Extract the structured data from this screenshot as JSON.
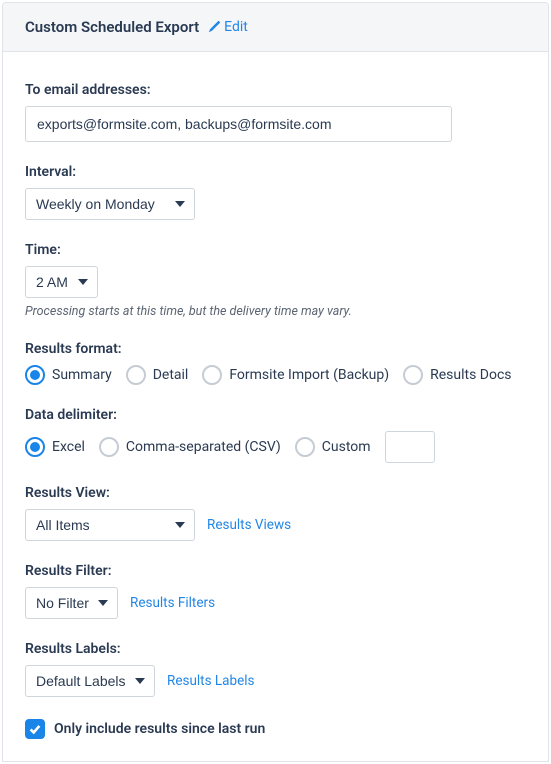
{
  "panel": {
    "title": "Custom Scheduled Export",
    "edit_label": "Edit"
  },
  "email": {
    "label": "To email addresses:",
    "value": "exports@formsite.com, backups@formsite.com"
  },
  "interval": {
    "label": "Interval:",
    "value": "Weekly on Monday"
  },
  "time": {
    "label": "Time:",
    "value": "2 AM",
    "hint": "Processing starts at this time, but the delivery time may vary."
  },
  "results_format": {
    "label": "Results format:",
    "options": {
      "summary": "Summary",
      "detail": "Detail",
      "formsite_import": "Formsite Import (Backup)",
      "results_docs": "Results Docs"
    }
  },
  "data_delimiter": {
    "label": "Data delimiter:",
    "options": {
      "excel": "Excel",
      "csv": "Comma-separated (CSV)",
      "custom": "Custom"
    }
  },
  "results_view": {
    "label": "Results View:",
    "value": "All Items",
    "link": "Results Views"
  },
  "results_filter": {
    "label": "Results Filter:",
    "value": "No Filter",
    "link": "Results Filters"
  },
  "results_labels": {
    "label": "Results Labels:",
    "value": "Default Labels",
    "link": "Results Labels"
  },
  "only_since_last": {
    "label": "Only include results since last run"
  }
}
